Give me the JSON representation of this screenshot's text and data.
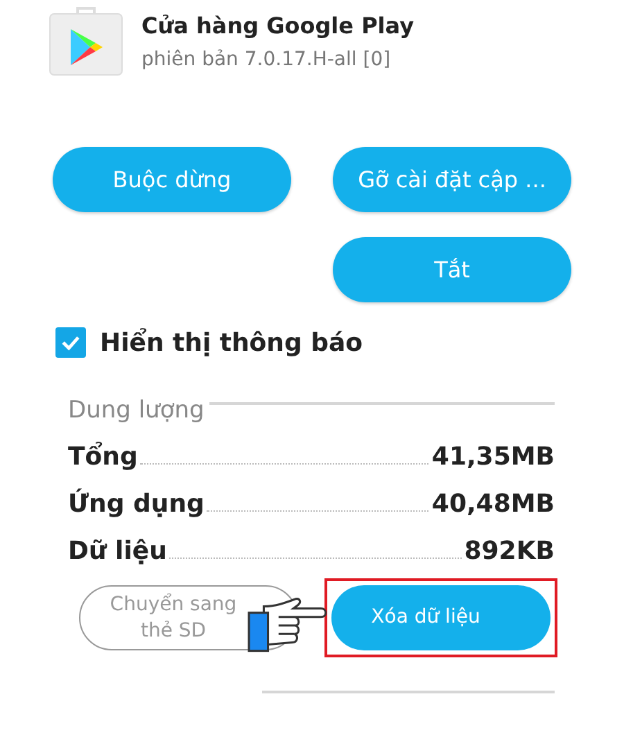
{
  "app": {
    "name": "Cửa hàng Google Play",
    "version": "phiên bản 7.0.17.H-all [0]"
  },
  "actions": [
    {
      "label": "Buộc dừng",
      "disabled": false
    },
    {
      "label": "Gỡ cài đặt cập ...",
      "disabled": false
    },
    {
      "label": "Tắt",
      "disabled": false
    }
  ],
  "notifications": {
    "label": "Hiển thị thông báo",
    "checked": true
  },
  "storage": {
    "title": "Dung lượng",
    "rows": [
      {
        "label": "Tổng",
        "value": "41,35MB"
      },
      {
        "label": "Ứng dụng",
        "value": "40,48MB"
      },
      {
        "label": "Dữ liệu",
        "value": "892KB"
      }
    ],
    "buttons": [
      {
        "label": "Chuyển sang thẻ SD",
        "disabled": true,
        "highlighted": false
      },
      {
        "label": "Xóa dữ liệu",
        "disabled": false,
        "highlighted": true
      }
    ]
  }
}
